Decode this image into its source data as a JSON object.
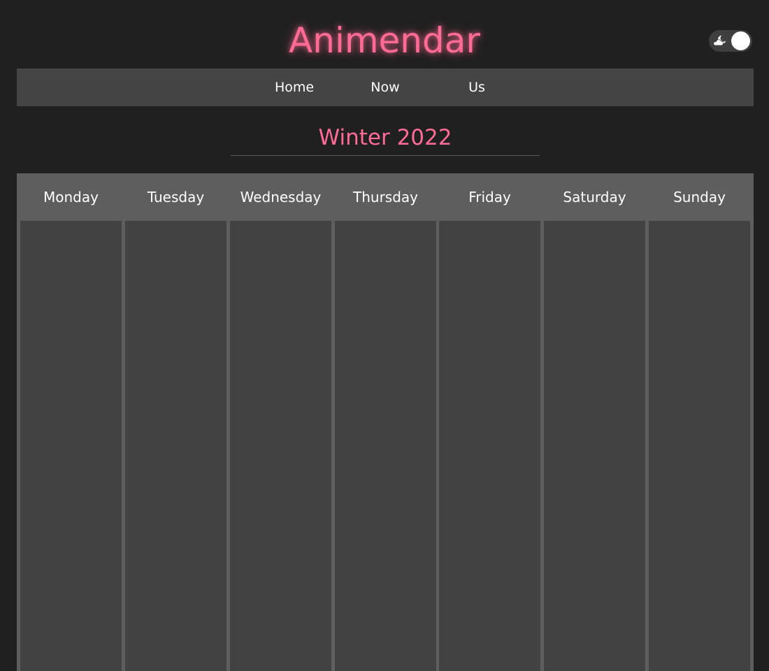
{
  "app": {
    "brand": "Animendar"
  },
  "theme_toggle": {
    "icon": "moon-cloud-icon",
    "state": "dark"
  },
  "nav": {
    "items": [
      {
        "label": "Home"
      },
      {
        "label": "Now"
      },
      {
        "label": "Us"
      }
    ]
  },
  "season": {
    "title": "Winter 2022"
  },
  "calendar": {
    "days": [
      {
        "label": "Monday"
      },
      {
        "label": "Tuesday"
      },
      {
        "label": "Wednesday"
      },
      {
        "label": "Thursday"
      },
      {
        "label": "Friday"
      },
      {
        "label": "Saturday"
      },
      {
        "label": "Sunday"
      }
    ]
  },
  "colors": {
    "accent": "#ff6b95",
    "background": "#202020",
    "nav_background": "#444444",
    "calendar_header": "#5e5e5e",
    "day_column": "#424242"
  }
}
